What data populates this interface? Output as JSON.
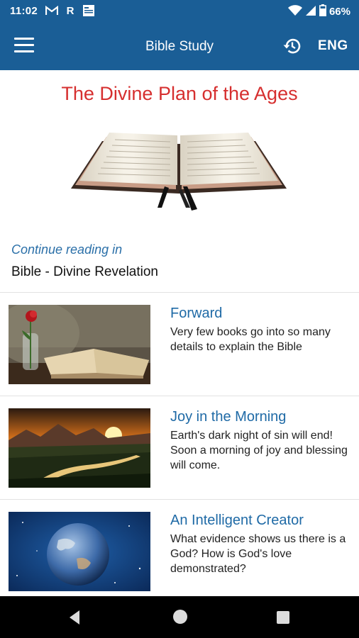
{
  "status": {
    "time": "11:02",
    "battery": "66%"
  },
  "appbar": {
    "title": "Bible Study",
    "language": "ENG"
  },
  "book": {
    "title": "The Divine Plan of the Ages"
  },
  "continue": {
    "label": "Continue reading in",
    "book": "Bible - Divine Revelation"
  },
  "items": [
    {
      "title": "Forward",
      "description": "Very few books go into so many details to explain the Bible"
    },
    {
      "title": "Joy in the Morning",
      "description": "Earth's dark night of sin will end! Soon a morning of joy and blessing will come."
    },
    {
      "title": "An Intelligent Creator",
      "description": "What evidence shows us there is a God? How is God's love demonstrated?"
    }
  ],
  "colors": {
    "primary": "#1a5e96",
    "title_red": "#d62f2f",
    "link_blue": "#1f6aa6"
  },
  "icons": [
    "gmail-icon",
    "r-icon",
    "news-icon",
    "wifi-icon",
    "signal-icon",
    "battery-icon",
    "menu-icon",
    "history-icon",
    "back-icon",
    "home-icon",
    "recents-icon"
  ]
}
